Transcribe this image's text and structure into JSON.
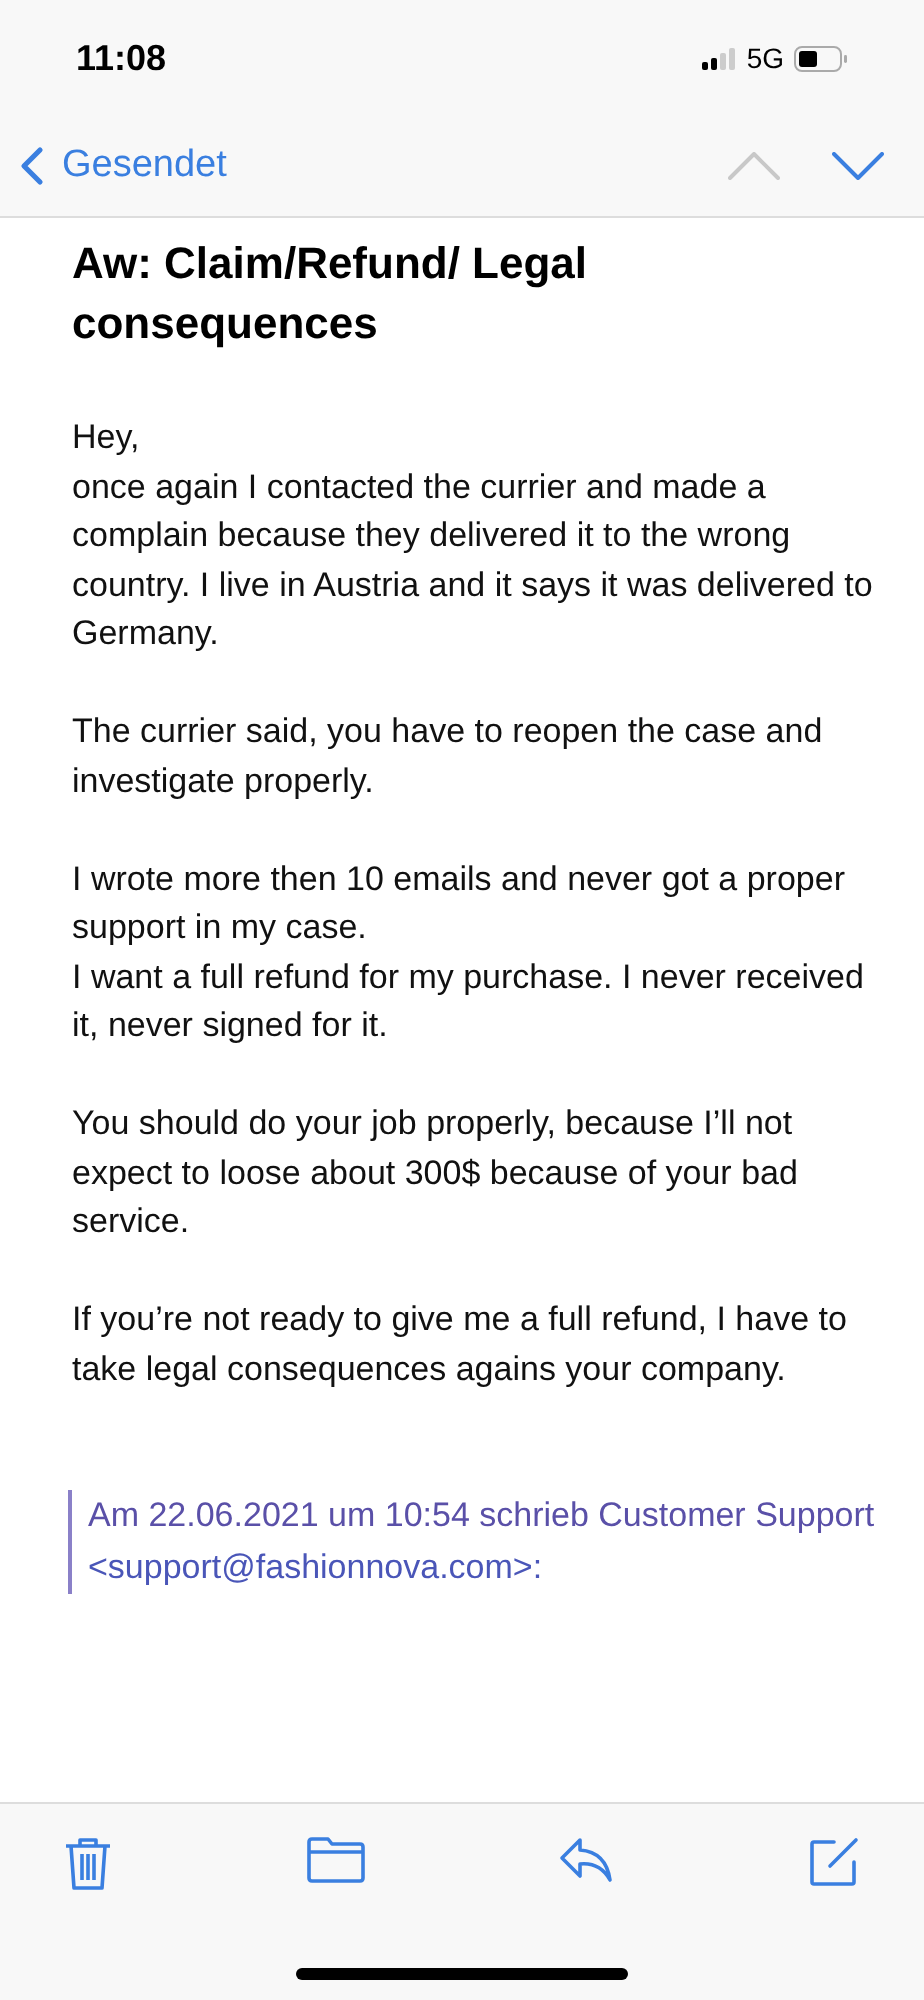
{
  "status_bar": {
    "time": "11:08",
    "network": "5G"
  },
  "nav": {
    "back_label": "Gesendet",
    "previous_disabled": true,
    "next_disabled": false
  },
  "subject": "Aw: Claim/Refund/ Legal consequences",
  "body": [
    [
      "Hey,",
      "once again I contacted the currier and made a complain because they delivered it to the wrong country. I live in Austria and it says it was delivered to Germany."
    ],
    [
      "The currier said, you have to reopen the case and investigate properly."
    ],
    [
      "I wrote more then 10 emails and never got a proper support in my case.",
      "I want a full refund for my purchase. I never received it, never signed for it."
    ],
    [
      "You should do your job properly, because I’ll not expect to loose about 300$ because of your bad service."
    ],
    [
      "If you’re not ready to give me a full refund, I have to take legal consequences agains your company."
    ]
  ],
  "quote": {
    "header": "Am 22.06.2021 um 10:54 schrieb Customer Support",
    "email": "<support@fashionnova.com>:"
  }
}
